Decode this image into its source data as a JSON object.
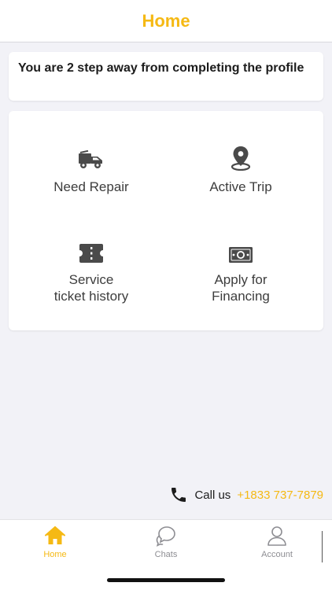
{
  "header": {
    "title": "Home"
  },
  "profile_banner": {
    "text": "You are 2 step away from completing the profile"
  },
  "tiles": [
    {
      "label": "Need Repair",
      "icon": "tow-truck-icon"
    },
    {
      "label": "Active Trip",
      "icon": "map-pin-icon"
    },
    {
      "label": "Service\nticket history",
      "icon": "ticket-icon"
    },
    {
      "label": "Apply for\nFinancing",
      "icon": "cash-icon"
    }
  ],
  "call": {
    "label": "Call us",
    "number": "+1833 737-7879",
    "icon": "phone-icon"
  },
  "tabbar": {
    "items": [
      {
        "label": "Home",
        "icon": "home-icon",
        "active": true
      },
      {
        "label": "Chats",
        "icon": "chat-bubbles-icon",
        "active": false
      },
      {
        "label": "Account",
        "icon": "user-icon",
        "active": false
      }
    ]
  },
  "colors": {
    "accent": "#f5b914",
    "icon_gray": "#4a4a4a",
    "background": "#f2f2f7"
  }
}
